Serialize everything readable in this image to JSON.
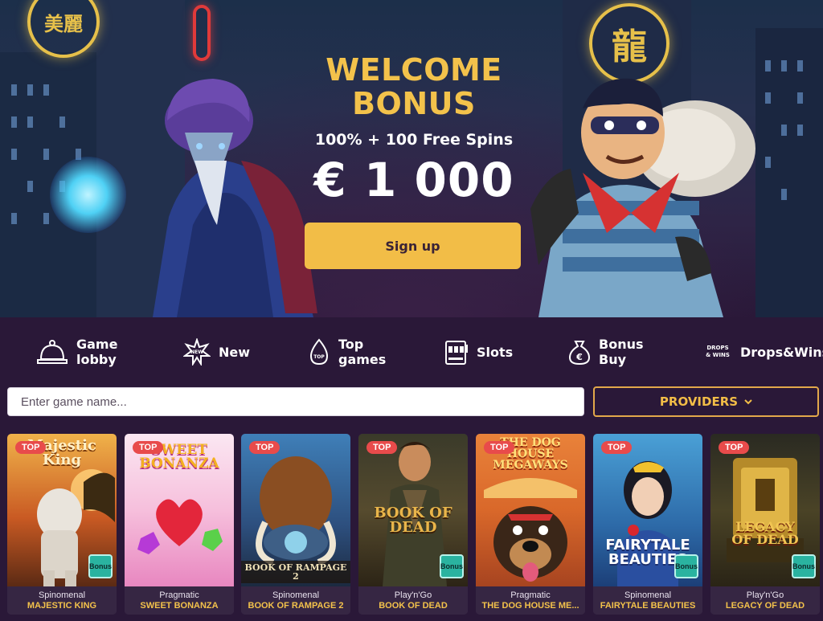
{
  "hero": {
    "title": "WELCOME\nBONUS",
    "subtitle": "100% + 100 Free Spins",
    "amount": "€ 1 000",
    "cta": "Sign up",
    "sign_left": "美麗",
    "sign_right": "龍"
  },
  "categories": [
    {
      "label": "Game\nlobby",
      "icon": "bell-icon"
    },
    {
      "label": "New",
      "icon": "star-burst-icon"
    },
    {
      "label": "Top\ngames",
      "icon": "flame-top-icon"
    },
    {
      "label": "Slots",
      "icon": "slot-machine-icon"
    },
    {
      "label": "Bonus\nBuy",
      "icon": "money-bag-icon"
    },
    {
      "label": "Drops&Wins",
      "icon": "drops-wins-icon",
      "icon_text": "DROPS\n& WINS"
    }
  ],
  "search": {
    "placeholder": "Enter game name...",
    "providers_label": "PROVIDERS"
  },
  "games": [
    {
      "provider": "Spinomenal",
      "name": "MAJESTIC KING",
      "badge": "TOP",
      "bonus": "Bonus",
      "logo": "Majestic\nKing"
    },
    {
      "provider": "Pragmatic",
      "name": "SWEET BONANZA",
      "badge": "TOP",
      "logo": "SWEET\nBONANZA"
    },
    {
      "provider": "Spinomenal",
      "name": "BOOK OF RAMPAGE 2",
      "badge": "TOP",
      "logo": "BOOK OF RAMPAGE 2"
    },
    {
      "provider": "Play'n'Go",
      "name": "BOOK OF DEAD",
      "badge": "TOP",
      "bonus": "Bonus",
      "logo": "BOOK OF\nDEAD"
    },
    {
      "provider": "Pragmatic",
      "name": "THE DOG HOUSE ME...",
      "badge": "TOP",
      "logo": "THE DOG\nHOUSE\nMEGAWAYS"
    },
    {
      "provider": "Spinomenal",
      "name": "FAIRYTALE BEAUTIES",
      "badge": "TOP",
      "bonus": "Bonus",
      "logo": "FAIRYTALE\nBEAUTIES"
    },
    {
      "provider": "Play'n'Go",
      "name": "LEGACY OF DEAD",
      "badge": "TOP",
      "bonus": "Bonus",
      "logo": "LEGACY\nOF DEAD"
    }
  ],
  "colors": {
    "accent": "#f2bd47",
    "background": "#2a1838",
    "top_badge": "#e84b4b",
    "bonus_badge": "#2ab3a0"
  }
}
